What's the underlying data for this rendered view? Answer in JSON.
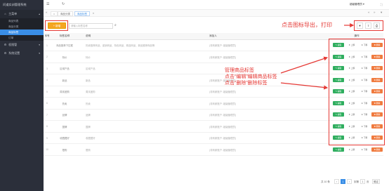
{
  "sidebar": {
    "brand": "问道实训管理系统",
    "menu": [
      {
        "label": "主菜单",
        "icon": "home-icon"
      },
      {
        "label": "权限管",
        "icon": "gear-icon"
      },
      {
        "label": "系统设置",
        "icon": "gear-icon"
      }
    ],
    "submenu": [
      "商品列表",
      "商品分类",
      "商品标签",
      "订单"
    ]
  },
  "topbar": {
    "user": "超级管理员 ▾"
  },
  "tabs": [
    "首页",
    "商品分类",
    "商品标签"
  ],
  "toolbar": {
    "add_label": "+ 新增",
    "search_placeholder": "请输入标签名称"
  },
  "table": {
    "headers": [
      "序号",
      "标签名称",
      "说明",
      "添加人",
      "操作"
    ],
    "rows": [
      {
        "no": "1",
        "name": "商品推荐下拉框",
        "desc": "热卖推荐商品、促销商品、特色商品、精选商品、新品推荐商品等",
        "user": "(非商家账户: 超级管理员)"
      },
      {
        "no": "2",
        "name": "特价",
        "desc": "特价",
        "user": "(非商家账户: 超级管理员)"
      },
      {
        "no": "3",
        "name": "区域产品",
        "desc": "区域产品",
        "user": ""
      },
      {
        "no": "4",
        "name": "新品",
        "desc": "新品",
        "user": "(非商家账户: 超级管理员)"
      },
      {
        "no": "5",
        "name": "周末团购",
        "desc": "周末团购",
        "user": "(非商家账户: 超级管理员)"
      },
      {
        "no": "6",
        "name": "热卖",
        "desc": "热卖",
        "user": "(非商家账户: 超级管理员)"
      },
      {
        "no": "7",
        "name": "品牌",
        "desc": "品牌",
        "user": "(非商家账户: 超级管理员)"
      },
      {
        "no": "8",
        "name": "国牌",
        "desc": "国牌",
        "user": "(非商家账户: 超级管理员)"
      },
      {
        "no": "9",
        "name": "收藏藏好",
        "desc": "收藏藏好",
        "user": "(非商家账户: 超级管理员)"
      },
      {
        "no": "10",
        "name": "限购",
        "desc": "限购",
        "user": "(非商家账户: 超级管理员)"
      }
    ],
    "ops": {
      "edit": "✎ 编辑",
      "up": "⬆ 上移",
      "down": "⬇ 下移",
      "del": "✖ 删除"
    }
  },
  "annotations": {
    "export_print": "点击图标导出，打印",
    "manage": [
      "管理商品标签",
      "点击“编辑”编辑商品标签",
      "点击“删除”删除标签"
    ]
  },
  "pagination": {
    "total": "共 10 条",
    "pages": [
      "1"
    ],
    "goto": "到第",
    "page_input": "1",
    "unit": "页",
    "confirm": "确定"
  },
  "colors": {
    "sidebar_bg": "#2b2f3a",
    "active_blue": "#3a8ee6",
    "add_orange": "#f5a623",
    "edit_green": "#2fae5f",
    "delete_orange": "#f07b3f",
    "annotation_red": "#e53935"
  }
}
